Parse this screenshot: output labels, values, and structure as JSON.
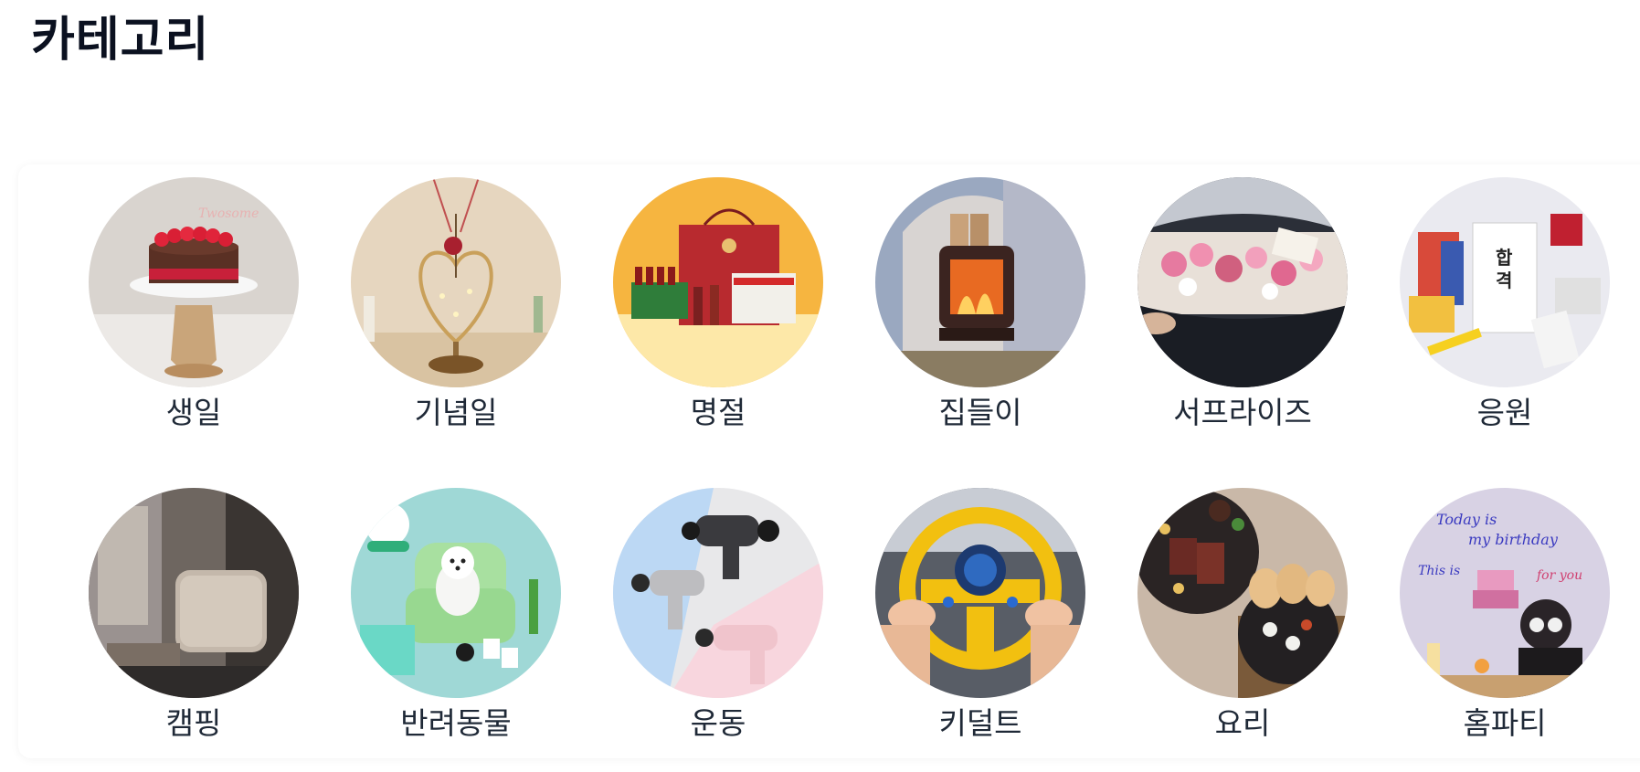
{
  "page": {
    "title": "카테고리"
  },
  "categories": [
    {
      "label": "생일",
      "image": "birthday-cake-image"
    },
    {
      "label": "기념일",
      "image": "heart-lamp-image"
    },
    {
      "label": "명절",
      "image": "holiday-gift-set-image"
    },
    {
      "label": "집들이",
      "image": "fireplace-lantern-image"
    },
    {
      "label": "서프라이즈",
      "image": "car-trunk-flowers-image"
    },
    {
      "label": "응원",
      "image": "cheer-snack-pack-image"
    },
    {
      "label": "캠핑",
      "image": "camping-luggage-image"
    },
    {
      "label": "반려동물",
      "image": "pet-dog-image"
    },
    {
      "label": "운동",
      "image": "massage-gun-image"
    },
    {
      "label": "키덜트",
      "image": "toy-steering-wheel-image"
    },
    {
      "label": "요리",
      "image": "steak-dishes-image"
    },
    {
      "label": "홈파티",
      "image": "birthday-party-projection-image"
    }
  ]
}
